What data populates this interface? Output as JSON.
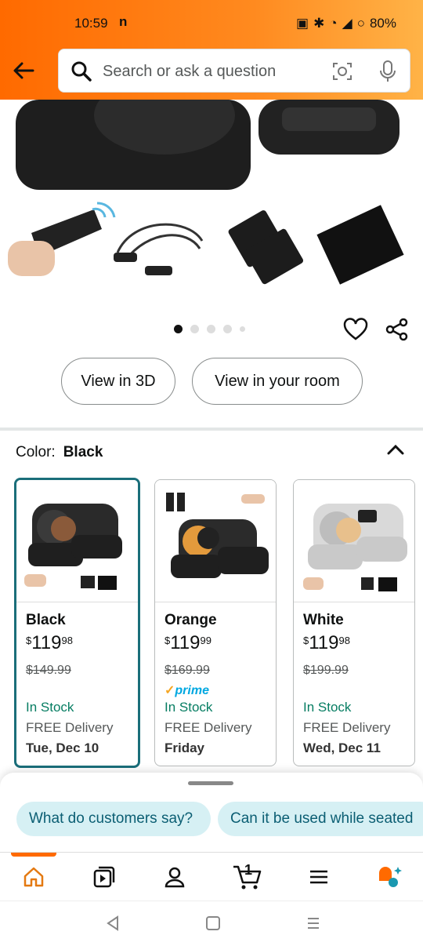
{
  "status": {
    "time": "10:59",
    "carrier": "n",
    "battery": "80%"
  },
  "search": {
    "placeholder": "Search or ask a question"
  },
  "product": {
    "view3d": "View in 3D",
    "view_room": "View in your room",
    "color_label": "Color:",
    "color_value": "Black"
  },
  "variants": [
    {
      "name": "Black",
      "price_dollars": "119",
      "price_cents": "98",
      "was": "$149.99",
      "prime": "",
      "stock": "In Stock",
      "delivery": "FREE Delivery",
      "date": "Tue, Dec 10"
    },
    {
      "name": "Orange",
      "price_dollars": "119",
      "price_cents": "99",
      "was": "$169.99",
      "prime": "prime",
      "stock": "In Stock",
      "delivery": "FREE Delivery",
      "date": "Friday"
    },
    {
      "name": "White",
      "price_dollars": "119",
      "price_cents": "98",
      "was": "$199.99",
      "prime": "",
      "stock": "In Stock",
      "delivery": "FREE Delivery",
      "date": "Wed, Dec 11"
    }
  ],
  "currency": "$",
  "questions": [
    "What do customers say?",
    "Can it be used while seated"
  ],
  "cart_count": "1",
  "colors": {
    "header": "#ff6a00",
    "selected_border": "#1a6e7a",
    "stock_green": "#067d62",
    "chip_bg": "#d6f0f4"
  }
}
